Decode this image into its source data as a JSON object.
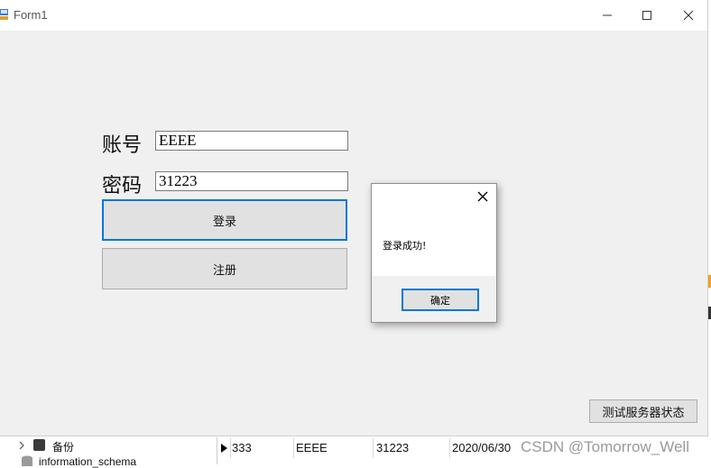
{
  "window": {
    "title": "Form1"
  },
  "form": {
    "account_label": "账号",
    "account_value": "EEEE",
    "password_label": "密码",
    "password_value": "31223",
    "login_label": "登录",
    "register_label": "注册",
    "server_status_label": "测试服务器状态"
  },
  "dialog": {
    "message": "登录成功!",
    "ok_label": "确定"
  },
  "background": {
    "tree_items": [
      "备份",
      "information_schema"
    ],
    "grid_row": [
      "333",
      "EEEE",
      "31223",
      "2020/06/30"
    ],
    "watermark": "CSDN @Tomorrow_Well"
  },
  "colors": {
    "accent": "#0078d7",
    "window_bg": "#f0f0f0",
    "button_bg": "#e1e1e1"
  }
}
